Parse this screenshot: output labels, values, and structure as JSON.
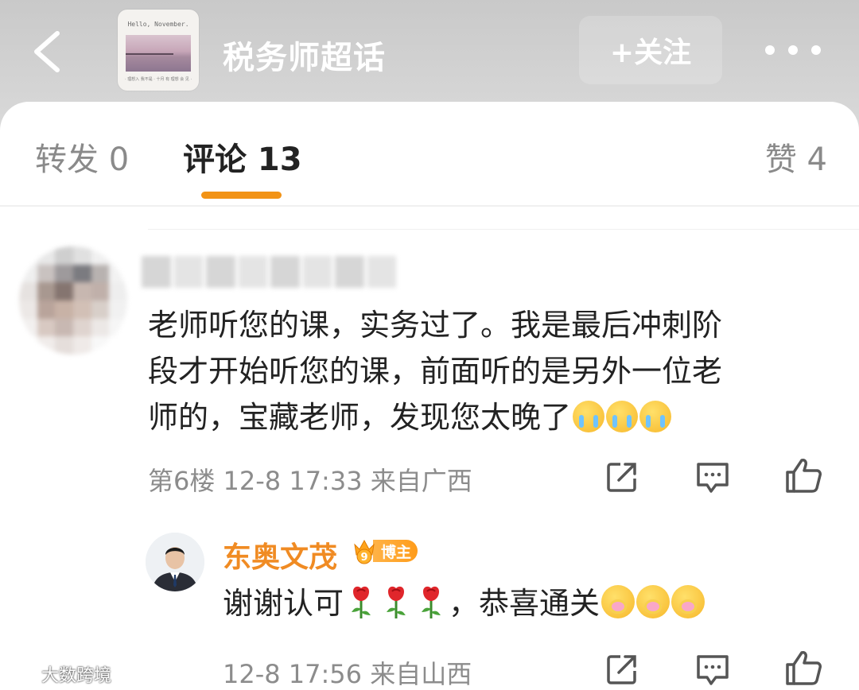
{
  "header": {
    "back_icon": "chevron-left-icon",
    "thumbnail_title": "Hello, November.",
    "thumbnail_caption": "· 理想入 我不是 · 十月 有 理想 会 见 ·",
    "topic_title": "税务师超话",
    "follow_label": "+关注",
    "more_icon": "more-dots-icon"
  },
  "tabs": {
    "repost": "转发 0",
    "comment": "评论 13",
    "like": "赞 4",
    "active_color": "#f29316"
  },
  "comment": {
    "text_line1": "老师听您的课，实务过了。我是最后冲刺阶",
    "text_line2": "段才开始听您的课，前面听的是另外一位老",
    "text_line3": "师的，宝藏老师，发现您太晚了",
    "emoji": "crying-emoji",
    "meta": "第6楼  12-8 17:33  来自广西"
  },
  "reply": {
    "name": "东奥文茂",
    "badge": "博主",
    "text_part1": "谢谢认可",
    "text_part2": "，恭喜通关",
    "meta": "12-8 17:56  来自山西",
    "name_color": "#f08b23"
  },
  "watermark": "大数跨境"
}
